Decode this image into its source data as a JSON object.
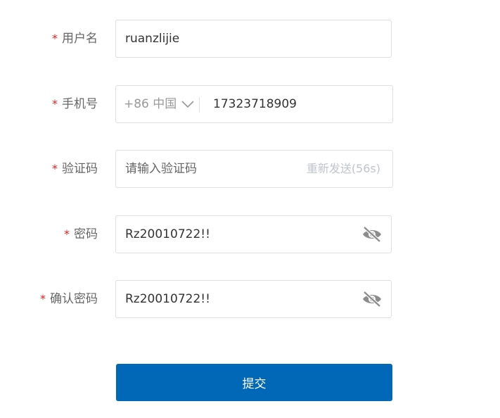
{
  "form": {
    "username": {
      "required_mark": "*",
      "label": "用户名",
      "value": "ruanzlijie"
    },
    "phone": {
      "required_mark": "*",
      "label": "手机号",
      "country_code": "+86 中国",
      "value": "17323718909"
    },
    "code": {
      "required_mark": "*",
      "label": "验证码",
      "placeholder": "请输入验证码",
      "resend_label": "重新发送(56s)"
    },
    "password": {
      "required_mark": "*",
      "label": "密码",
      "value": "Rz20010722!!",
      "toggle_icon": "eye-slash-icon"
    },
    "confirm_password": {
      "required_mark": "*",
      "label": "确认密码",
      "value": "Rz20010722!!",
      "toggle_icon": "eye-slash-icon"
    },
    "submit_label": "提交"
  },
  "colors": {
    "primary": "#0068b7",
    "required": "#e02020",
    "label": "#666666",
    "border": "#dcdfe6"
  }
}
